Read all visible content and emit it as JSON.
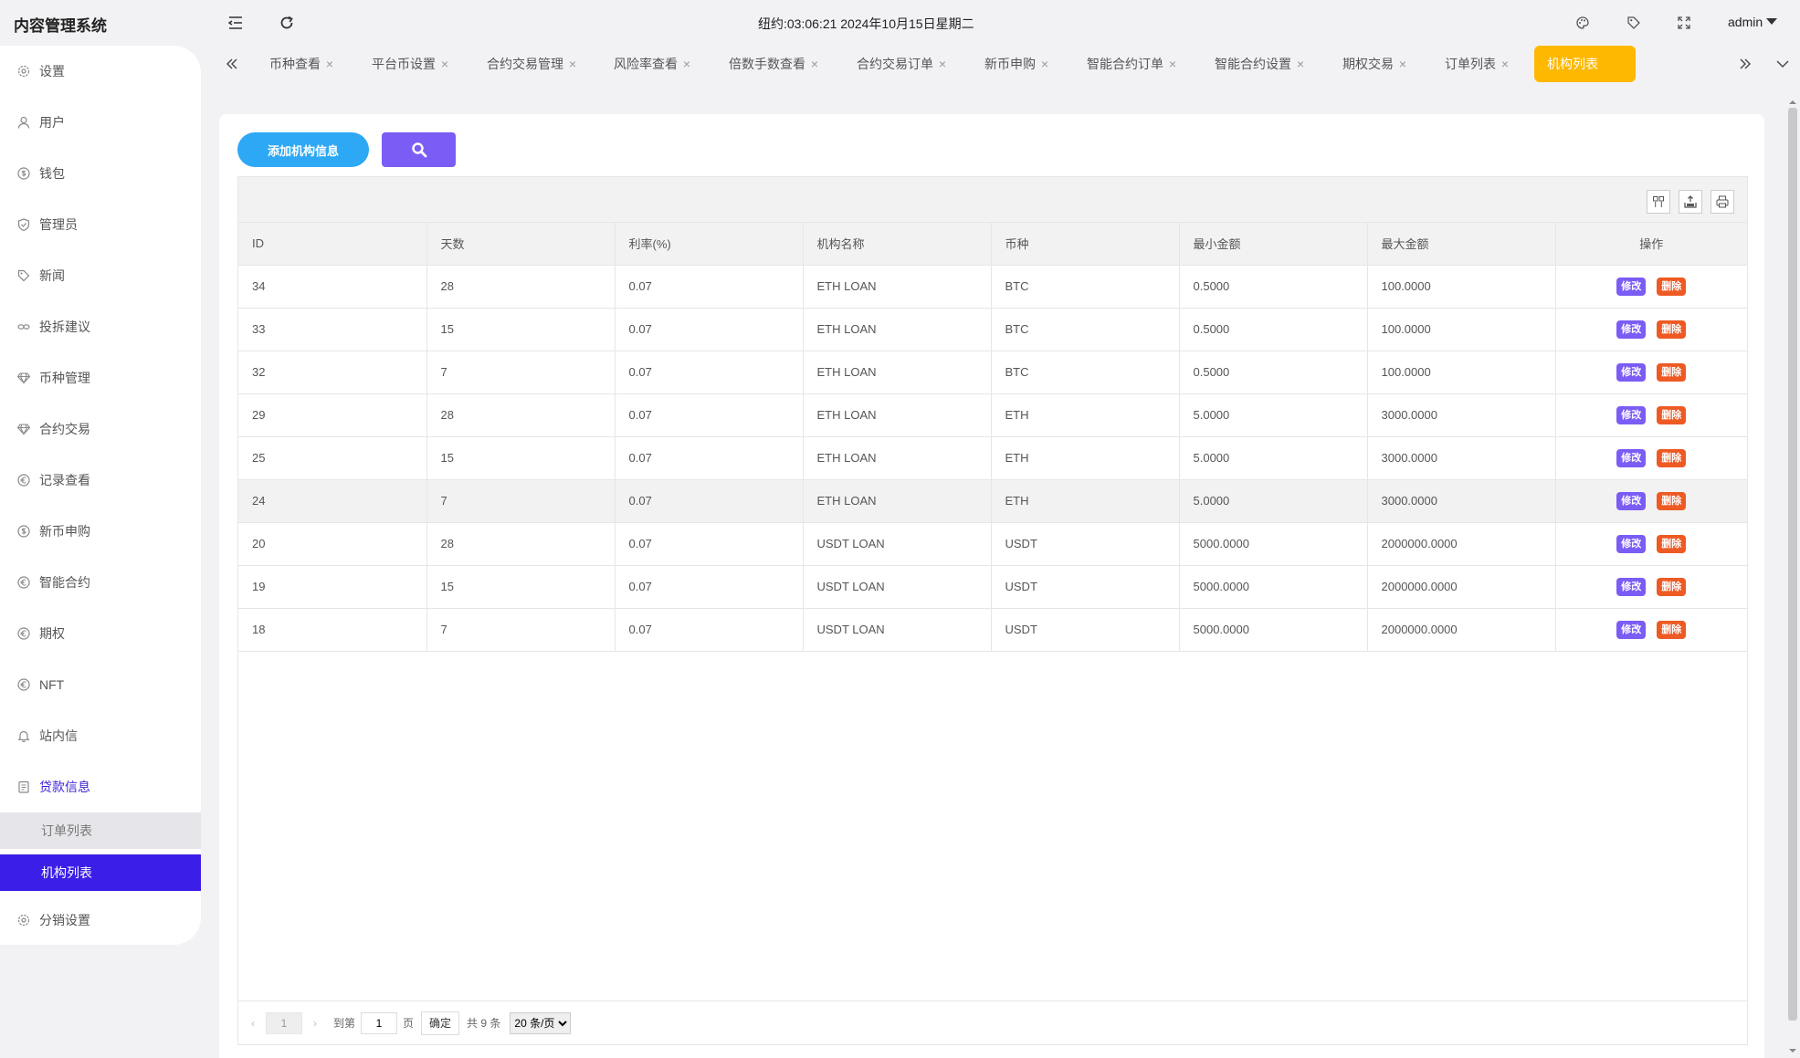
{
  "header": {
    "app_title": "内容管理系统",
    "clock": "纽约:03:06:21 2024年10月15日星期二",
    "user": "admin"
  },
  "sidebar": {
    "items": [
      {
        "label": "设置",
        "icon": "gear-icon"
      },
      {
        "label": "用户",
        "icon": "user-icon"
      },
      {
        "label": "钱包",
        "icon": "coin-icon"
      },
      {
        "label": "管理员",
        "icon": "shield-icon"
      },
      {
        "label": "新闻",
        "icon": "tag-icon"
      },
      {
        "label": "投拆建议",
        "icon": "link-icon"
      },
      {
        "label": "币种管理",
        "icon": "diamond-icon"
      },
      {
        "label": "合约交易",
        "icon": "diamond-icon"
      },
      {
        "label": "记录查看",
        "icon": "euro-icon"
      },
      {
        "label": "新币申购",
        "icon": "coin-icon"
      },
      {
        "label": "智能合约",
        "icon": "euro-icon"
      },
      {
        "label": "期权",
        "icon": "euro-icon"
      },
      {
        "label": "NFT",
        "icon": "euro-icon"
      },
      {
        "label": "站内信",
        "icon": "bell-icon"
      },
      {
        "label": "贷款信息",
        "icon": "document-icon"
      }
    ],
    "sub_items": [
      {
        "label": "订单列表"
      },
      {
        "label": "机构列表"
      }
    ],
    "last_item": {
      "label": "分销设置",
      "icon": "gear-icon"
    }
  },
  "tabs": [
    {
      "label": "币种查看"
    },
    {
      "label": "平台币设置"
    },
    {
      "label": "合约交易管理"
    },
    {
      "label": "风险率查看"
    },
    {
      "label": "倍数手数查看"
    },
    {
      "label": "合约交易订单"
    },
    {
      "label": "新币申购"
    },
    {
      "label": "智能合约订单"
    },
    {
      "label": "智能合约设置"
    },
    {
      "label": "期权交易"
    },
    {
      "label": "订单列表"
    },
    {
      "label": "机构列表"
    }
  ],
  "toolbar": {
    "add_label": "添加机构信息"
  },
  "table": {
    "columns": [
      "ID",
      "天数",
      "利率(%)",
      "机构名称",
      "币种",
      "最小金额",
      "最大金额",
      "操作"
    ],
    "rows": [
      [
        "34",
        "28",
        "0.07",
        "ETH LOAN",
        "BTC",
        "0.5000",
        "100.0000"
      ],
      [
        "33",
        "15",
        "0.07",
        "ETH LOAN",
        "BTC",
        "0.5000",
        "100.0000"
      ],
      [
        "32",
        "7",
        "0.07",
        "ETH LOAN",
        "BTC",
        "0.5000",
        "100.0000"
      ],
      [
        "29",
        "28",
        "0.07",
        "ETH LOAN",
        "ETH",
        "5.0000",
        "3000.0000"
      ],
      [
        "25",
        "15",
        "0.07",
        "ETH LOAN",
        "ETH",
        "5.0000",
        "3000.0000"
      ],
      [
        "24",
        "7",
        "0.07",
        "ETH LOAN",
        "ETH",
        "5.0000",
        "3000.0000"
      ],
      [
        "20",
        "28",
        "0.07",
        "USDT LOAN",
        "USDT",
        "5000.0000",
        "2000000.0000"
      ],
      [
        "19",
        "15",
        "0.07",
        "USDT LOAN",
        "USDT",
        "5000.0000",
        "2000000.0000"
      ],
      [
        "18",
        "7",
        "0.07",
        "USDT LOAN",
        "USDT",
        "5000.0000",
        "2000000.0000"
      ]
    ],
    "edit_label": "修改",
    "delete_label": "删除"
  },
  "pager": {
    "current": "1",
    "goto_label": "到第",
    "goto_value": "1",
    "page_unit": "页",
    "confirm_label": "确定",
    "total": "共 9 条",
    "page_size": "20 条/页"
  },
  "colors": {
    "accent": "#3b1fe8",
    "add_button": "#2da8f5",
    "search_button": "#7b5cf5",
    "active_tab": "#ffb800",
    "delete_button": "#ee5a24"
  }
}
